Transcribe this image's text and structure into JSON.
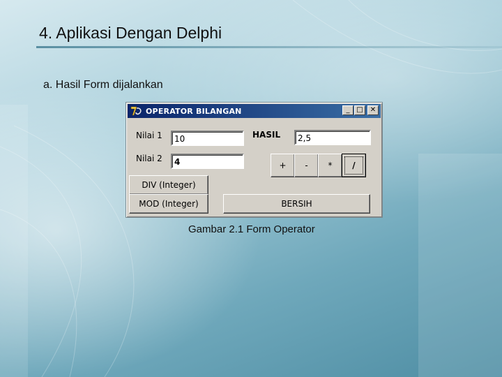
{
  "slide": {
    "title": "4. Aplikasi Dengan Delphi",
    "subtitle": "a. Hasil Form dijalankan",
    "caption": "Gambar 2.1 Form Operator"
  },
  "window": {
    "title": "OPERATOR BILANGAN",
    "minimize": "_",
    "maximize": "□",
    "close": "✕",
    "icon": "delphi-app-icon"
  },
  "form": {
    "nilai1_label": "Nilai 1",
    "nilai1_value": "10",
    "nilai2_label": "Nilai 2",
    "nilai2_value": "4",
    "hasil_label": "HASIL",
    "hasil_value": "2,5",
    "buttons": {
      "plus": "+",
      "minus": "-",
      "times": "*",
      "divide": "/",
      "div_integer": "DIV (Integer)",
      "mod_integer": "MOD (Integer)",
      "bersih": "BERSIH"
    }
  },
  "colors": {
    "titlebar_start": "#0a246a",
    "titlebar_end": "#3a6ea5",
    "face": "#d4d0c8"
  }
}
